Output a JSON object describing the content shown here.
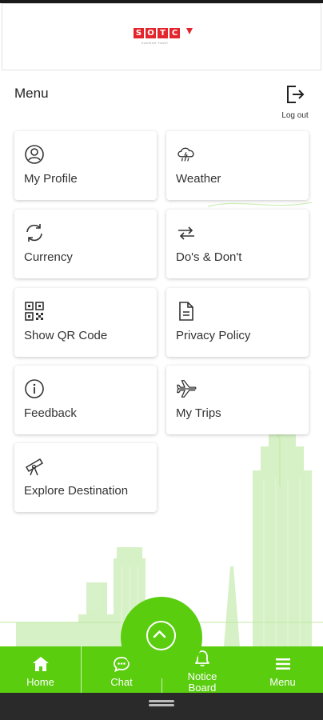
{
  "brand": {
    "letters": [
      "S",
      "O",
      "T",
      "C"
    ],
    "tagline": "Incentive Travel",
    "color": "#e3262d"
  },
  "menu": {
    "title": "Menu",
    "logout_label": "Log out",
    "logout_icon": "logout-icon"
  },
  "cards": [
    {
      "label": "My Profile",
      "icon": "profile-icon"
    },
    {
      "label": "Weather",
      "icon": "weather-icon"
    },
    {
      "label": "Currency",
      "icon": "currency-icon"
    },
    {
      "label": "Do's & Don't",
      "icon": "swap-icon"
    },
    {
      "label": "Show QR Code",
      "icon": "qr-code-icon"
    },
    {
      "label": "Privacy Policy",
      "icon": "document-icon"
    },
    {
      "label": "Feedback",
      "icon": "info-icon"
    },
    {
      "label": "My Trips",
      "icon": "airplane-icon"
    },
    {
      "label": "Explore Destination",
      "icon": "telescope-icon"
    }
  ],
  "bottom_nav": {
    "items": [
      {
        "label": "Home",
        "icon": "home-icon"
      },
      {
        "label": "Chat",
        "icon": "chat-icon"
      },
      {
        "label_line1": "Notice",
        "label_line2": "Board",
        "icon": "bell-icon"
      },
      {
        "label": "Menu",
        "icon": "hamburger-icon"
      }
    ],
    "fab_icon": "chevron-up-icon",
    "accent": "#5acd0e"
  }
}
